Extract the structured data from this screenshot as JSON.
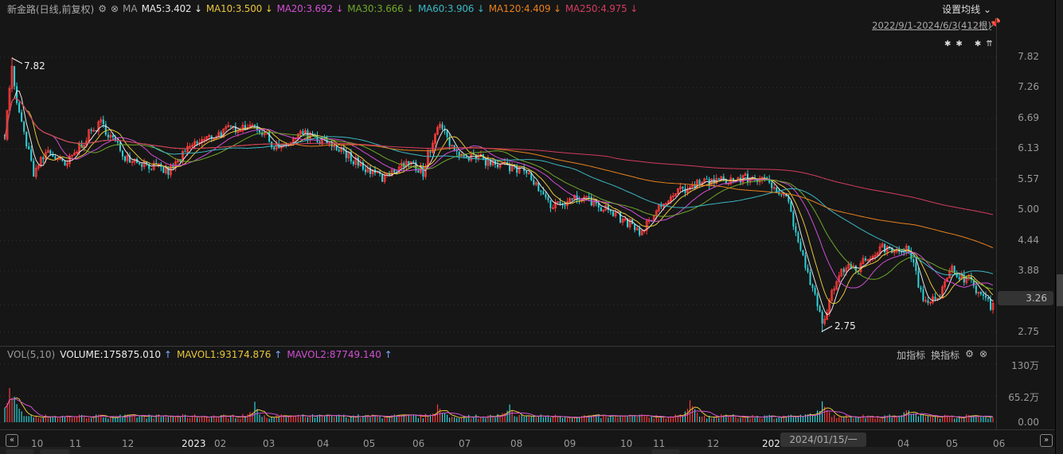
{
  "header": {
    "title": "新金路(日线,前复权)",
    "ma_label": "MA",
    "settings": "设置均线",
    "range": "2022/9/1-2024/6/3(412根)",
    "ma": [
      {
        "label": "MA5:3.402",
        "arrow": "↓",
        "color": "#e6e6e6"
      },
      {
        "label": "MA10:3.500",
        "arrow": "↓",
        "color": "#e8c53a"
      },
      {
        "label": "MA20:3.692",
        "arrow": "↓",
        "color": "#d04fd4"
      },
      {
        "label": "MA30:3.666",
        "arrow": "↓",
        "color": "#6fa72c"
      },
      {
        "label": "MA60:3.906",
        "arrow": "↓",
        "color": "#3ab8c4"
      },
      {
        "label": "MA120:4.409",
        "arrow": "↓",
        "color": "#e8801e"
      },
      {
        "label": "MA250:4.975",
        "arrow": "↓",
        "color": "#d23c5e"
      }
    ]
  },
  "price_axis": [
    "7.82",
    "7.26",
    "6.69",
    "6.13",
    "5.57",
    "5.00",
    "4.44",
    "3.88",
    "3.26",
    "2.75"
  ],
  "current_price": "3.26",
  "annotations": {
    "high": "7.82",
    "low": "2.75"
  },
  "volume": {
    "title": "VOL(5,10)",
    "items": [
      {
        "label": "VOLUME:175875.010",
        "arrow": "↑",
        "color": "#eeeeee"
      },
      {
        "label": "MAVOL1:93174.876",
        "arrow": "↑",
        "color": "#e8c53a"
      },
      {
        "label": "MAVOL2:87749.140",
        "arrow": "↑",
        "color": "#d04fd4"
      }
    ],
    "add": "加指标",
    "switch": "换指标",
    "axis": [
      "130万",
      "65.2万",
      "0.00"
    ]
  },
  "x_axis": [
    "10",
    "11",
    "12",
    "2023",
    "02",
    "03",
    "04",
    "05",
    "06",
    "07",
    "08",
    "09",
    "10",
    "11",
    "12",
    "2024",
    "04",
    "05",
    "06"
  ],
  "crosshair_label": "2024/01/15/一",
  "colors": {
    "up": "#ff3a3a",
    "down": "#2fd3da"
  },
  "chart_data": {
    "type": "candlestick",
    "count": 412,
    "ylim": [
      2.75,
      7.82
    ],
    "high": 7.82,
    "low": 2.75,
    "close_anchors": [
      [
        0,
        6.4
      ],
      [
        3,
        7.6
      ],
      [
        5,
        6.9
      ],
      [
        12,
        5.7
      ],
      [
        18,
        6.1
      ],
      [
        25,
        5.8
      ],
      [
        35,
        6.4
      ],
      [
        40,
        6.6
      ],
      [
        50,
        6.0
      ],
      [
        68,
        5.7
      ],
      [
        78,
        6.2
      ],
      [
        94,
        6.5
      ],
      [
        104,
        6.6
      ],
      [
        114,
        6.1
      ],
      [
        124,
        6.4
      ],
      [
        137,
        6.2
      ],
      [
        146,
        5.9
      ],
      [
        157,
        5.6
      ],
      [
        167,
        5.9
      ],
      [
        174,
        5.7
      ],
      [
        180,
        6.6
      ],
      [
        187,
        6.1
      ],
      [
        204,
        5.85
      ],
      [
        217,
        5.7
      ],
      [
        227,
        5.1
      ],
      [
        240,
        5.25
      ],
      [
        253,
        4.95
      ],
      [
        265,
        4.6
      ],
      [
        273,
        5.1
      ],
      [
        286,
        5.5
      ],
      [
        313,
        5.6
      ],
      [
        325,
        5.3
      ],
      [
        330,
        4.4
      ],
      [
        340,
        2.95
      ],
      [
        348,
        3.95
      ],
      [
        355,
        3.95
      ],
      [
        364,
        4.3
      ],
      [
        376,
        4.3
      ],
      [
        382,
        3.35
      ],
      [
        389,
        3.45
      ],
      [
        394,
        3.9
      ],
      [
        401,
        3.7
      ],
      [
        411,
        3.2
      ]
    ],
    "volume_spikes_wan": [
      [
        2,
        62
      ],
      [
        4,
        45
      ],
      [
        104,
        30
      ],
      [
        180,
        35
      ],
      [
        210,
        28
      ],
      [
        285,
        45
      ],
      [
        340,
        40
      ],
      [
        376,
        20
      ]
    ],
    "ma_periods": [
      5,
      10,
      20,
      30,
      60,
      120,
      250
    ],
    "vol_ma_periods": [
      5,
      10
    ],
    "vol_ylim": [
      0,
      130
    ]
  }
}
